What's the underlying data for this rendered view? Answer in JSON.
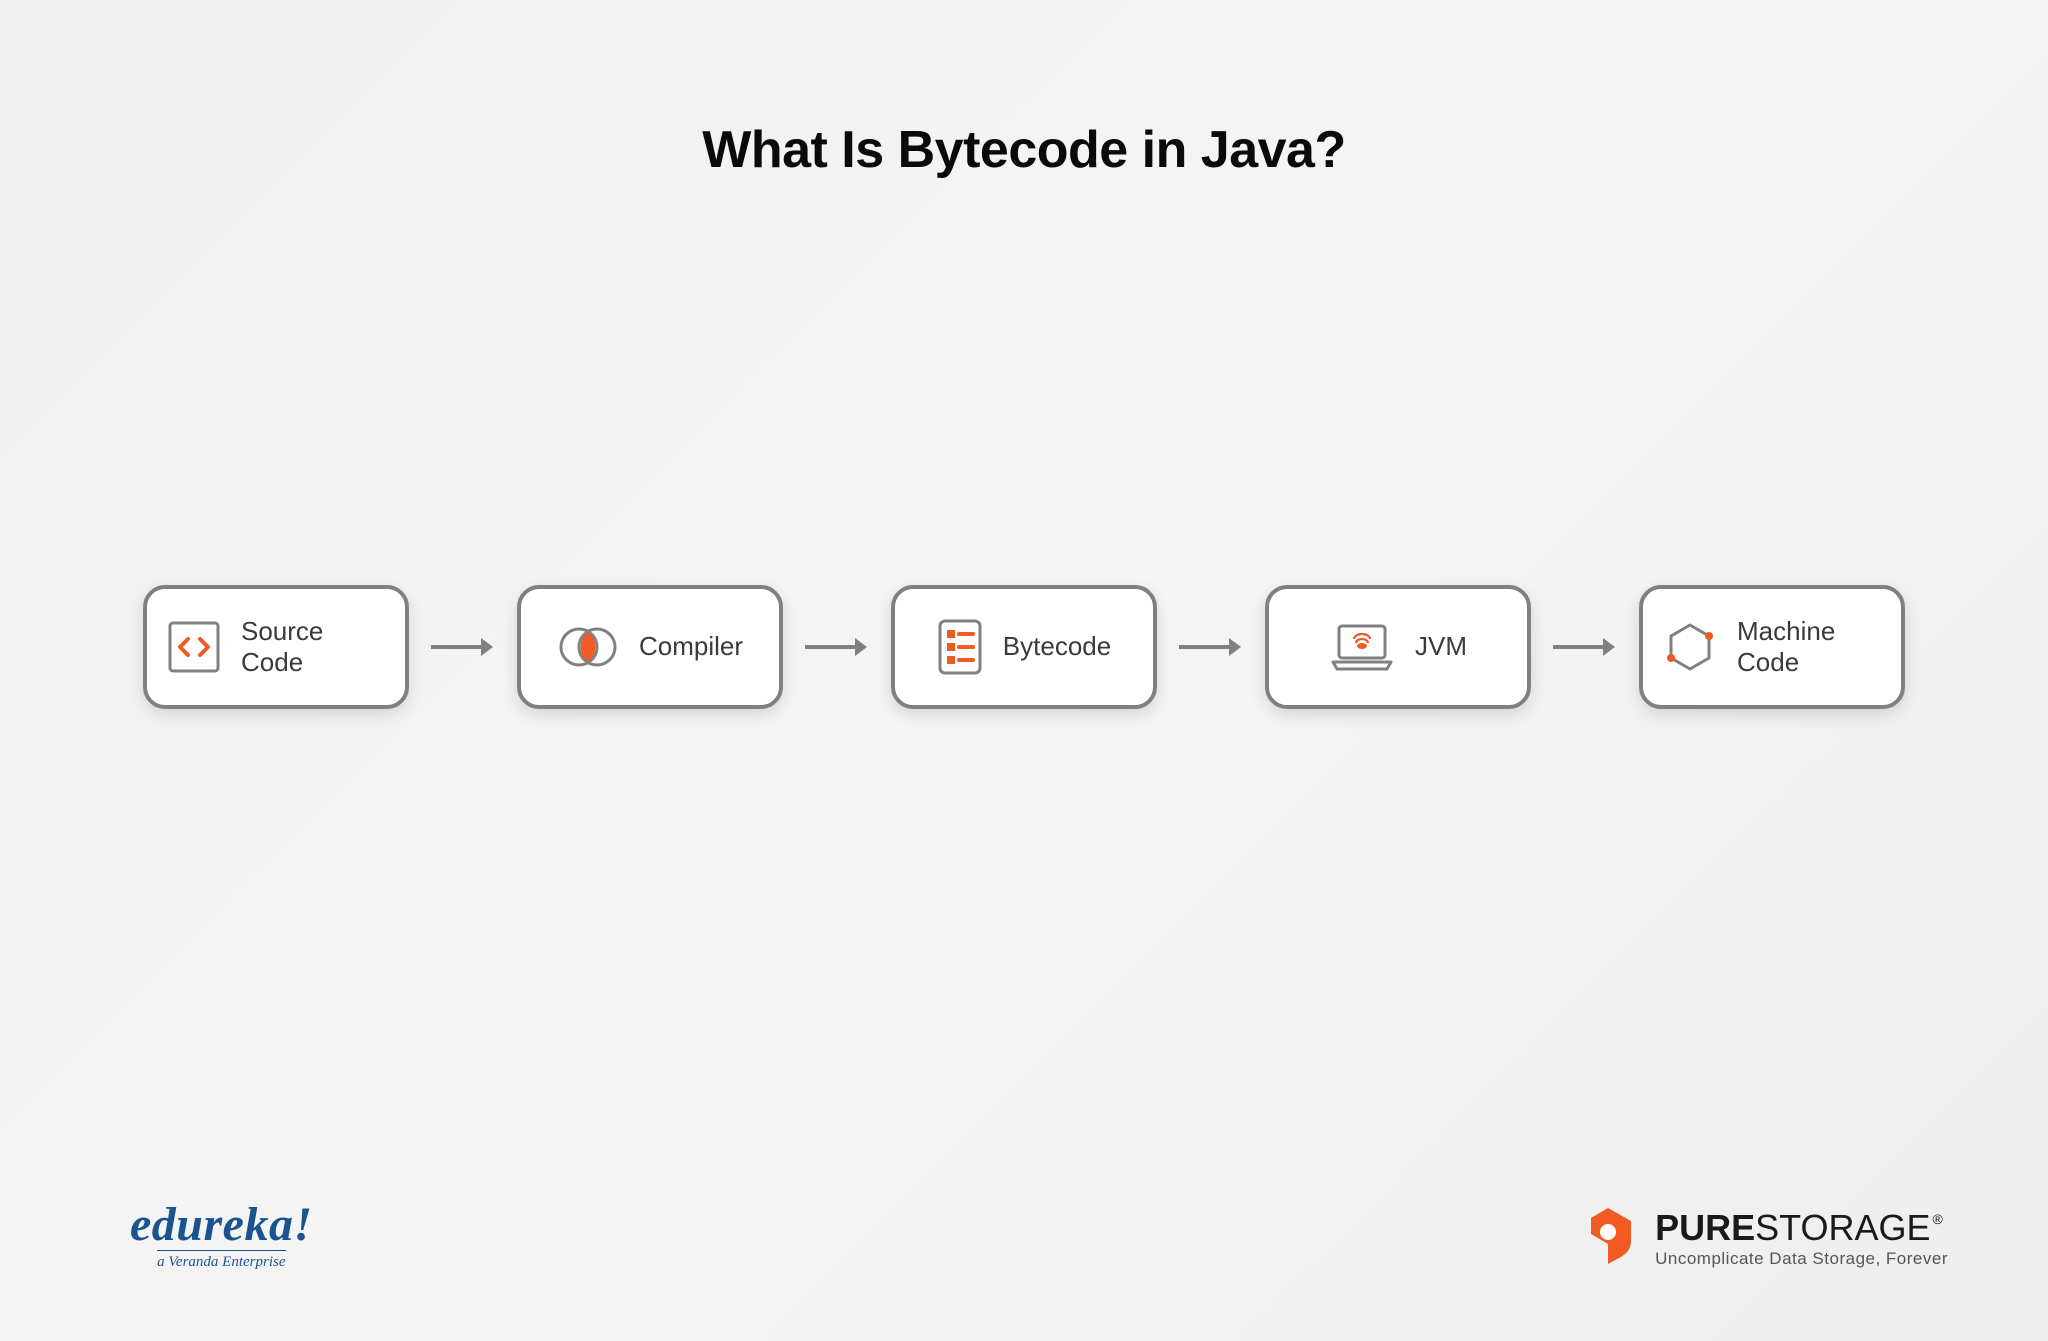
{
  "title": "What Is Bytecode in Java?",
  "flow": {
    "items": [
      {
        "label": "Source Code",
        "icon": "code-icon"
      },
      {
        "label": "Compiler",
        "icon": "venn-icon"
      },
      {
        "label": "Bytecode",
        "icon": "list-doc-icon"
      },
      {
        "label": "JVM",
        "icon": "laptop-icon"
      },
      {
        "label": "Machine Code",
        "icon": "hexagon-icon"
      }
    ]
  },
  "logos": {
    "left": {
      "brand": "edureka!",
      "tagline": "a Veranda Enterprise"
    },
    "right": {
      "brand_bold": "PURE",
      "brand_light": "STORAGE",
      "registered": "®",
      "tagline": "Uncomplicate Data Storage, Forever"
    }
  },
  "colors": {
    "accent": "#F15A22",
    "box_border": "#808080",
    "arrow": "#808080",
    "edureka_blue": "#1a5490"
  }
}
